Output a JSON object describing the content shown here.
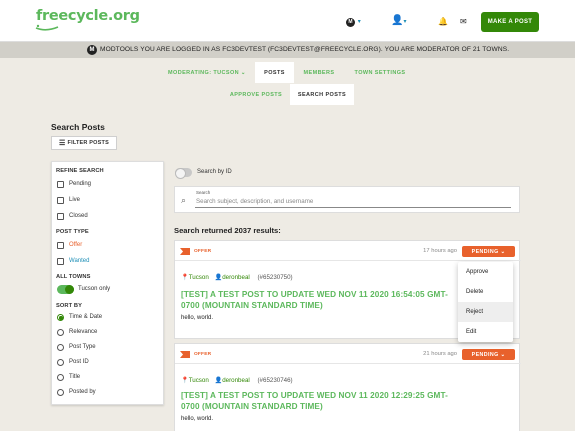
{
  "header": {
    "logo": "freecycle.org",
    "make_post": "MAKE A POST"
  },
  "modbar": {
    "badge": "M",
    "text": "MODTOOLS  YOU ARE LOGGED IN AS FC3DEVTEST (FC3DEVTEST@FREECYCLE.ORG). YOU ARE MODERATOR OF 21 TOWNS."
  },
  "tabs1": [
    "MODERATING: TUCSON ⌄",
    "POSTS",
    "MEMBERS",
    "TOWN SETTINGS"
  ],
  "tabs2": [
    "APPROVE POSTS",
    "SEARCH POSTS"
  ],
  "page": {
    "title": "Search Posts",
    "filter_btn": "FILTER POSTS"
  },
  "sidebar": {
    "refine": "REFINE SEARCH",
    "pending": "Pending",
    "live": "Live",
    "closed": "Closed",
    "post_type": "POST TYPE",
    "offer": "Offer",
    "wanted": "Wanted",
    "all_towns": "ALL TOWNS",
    "tucson_only": "Tucson only",
    "sort_by": "SORT BY",
    "sorts": [
      "Time & Date",
      "Relevance",
      "Post Type",
      "Post ID",
      "Title",
      "Posted by"
    ]
  },
  "search": {
    "by_id": "Search by ID",
    "label": "Search",
    "placeholder": "Search subject, description, and username"
  },
  "results": "Search returned 2037 results:",
  "posts": [
    {
      "type": "OFFER",
      "ago": "17 hours ago",
      "status": "PENDING ⌄",
      "town": "Tucson",
      "user": "deronbeal",
      "id": "(#65230750)",
      "title": "[TEST] A TEST POST TO UPDATE WED NOV 11 2020 16:54:05 GMT-0700 (MOUNTAIN STANDARD TIME)",
      "body": "hello, world."
    },
    {
      "type": "OFFER",
      "ago": "21 hours ago",
      "status": "PENDING ⌄",
      "town": "Tucson",
      "user": "deronbeal",
      "id": "(#65230746)",
      "title": "[TEST] A TEST POST TO UPDATE WED NOV 11 2020 12:29:25 GMT-0700 (MOUNTAIN STANDARD TIME)",
      "body": "hello, world."
    }
  ],
  "dropdown": [
    "Approve",
    "Delete",
    "Reject",
    "Edit"
  ],
  "colors": {
    "brand_green": "#5cb85c",
    "dark_green": "#338808",
    "offer_orange": "#e8612c"
  }
}
